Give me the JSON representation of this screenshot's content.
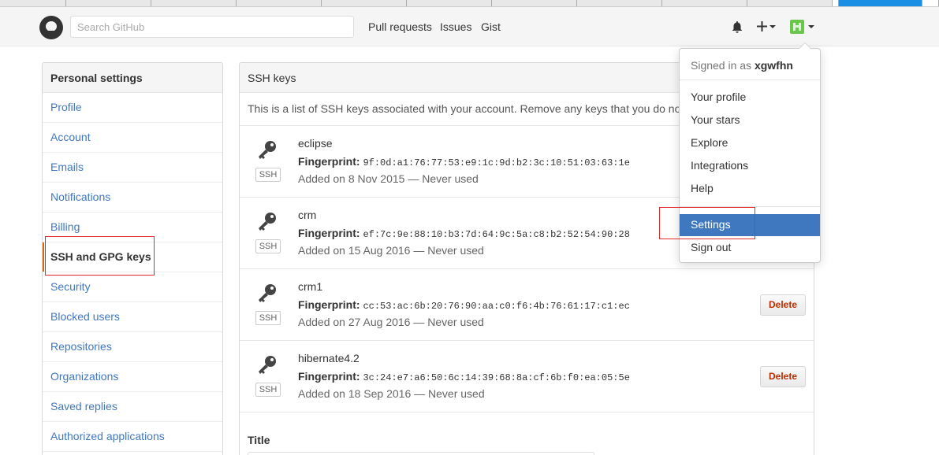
{
  "header": {
    "search_placeholder": "Search GitHub",
    "nav": [
      "Pull requests",
      "Issues",
      "Gist"
    ],
    "icons": [
      "github-logo-icon",
      "bell-icon",
      "plus-icon",
      "avatar"
    ]
  },
  "sidebar": {
    "heading": "Personal settings",
    "items": [
      {
        "label": "Profile"
      },
      {
        "label": "Account"
      },
      {
        "label": "Emails"
      },
      {
        "label": "Notifications"
      },
      {
        "label": "Billing"
      },
      {
        "label": "SSH and GPG keys",
        "selected": true
      },
      {
        "label": "Security"
      },
      {
        "label": "Blocked users"
      },
      {
        "label": "Repositories"
      },
      {
        "label": "Organizations"
      },
      {
        "label": "Saved replies"
      },
      {
        "label": "Authorized applications"
      }
    ]
  },
  "main": {
    "heading": "SSH keys",
    "description": "This is a list of SSH keys associated with your account. Remove any keys that you do not r",
    "fingerprint_label": "Fingerprint:",
    "badge": "SSH",
    "delete_label": "Delete",
    "keys": [
      {
        "title": "eclipse",
        "fingerprint": "9f:0d:a1:76:77:53:e9:1c:9d:b2:3c:10:51:03:63:1e",
        "added": "Added on 8 Nov 2015 — Never used",
        "show_delete": false
      },
      {
        "title": "crm",
        "fingerprint": "ef:7c:9e:88:10:b3:7d:64:9c:5a:c8:b2:52:54:90:28",
        "added": "Added on 15 Aug 2016 — Never used",
        "show_delete": false
      },
      {
        "title": "crm1",
        "fingerprint": "cc:53:ac:6b:20:76:90:aa:c0:f6:4b:76:61:17:c1:ec",
        "added": "Added on 27 Aug 2016 — Never used",
        "show_delete": true
      },
      {
        "title": "hibernate4.2",
        "fingerprint": "3c:24:e7:a6:50:6c:14:39:68:8a:cf:6b:f0:ea:05:5e",
        "added": "Added on 18 Sep 2016 — Never used",
        "show_delete": true
      }
    ],
    "title_label": "Title"
  },
  "dropdown": {
    "signed_in_prefix": "Signed in as",
    "username": "xgwfhn",
    "items": [
      {
        "label": "Your profile"
      },
      {
        "label": "Your stars"
      },
      {
        "label": "Explore"
      },
      {
        "label": "Integrations"
      },
      {
        "label": "Help"
      },
      {
        "label": "Settings",
        "active": true
      },
      {
        "label": "Sign out"
      }
    ]
  },
  "colors": {
    "link": "#4078c0",
    "selected_accent": "#d26911",
    "active_menu": "#4078c0",
    "annotation_red": "#e32b2b",
    "delete_text": "#bd2c00"
  }
}
